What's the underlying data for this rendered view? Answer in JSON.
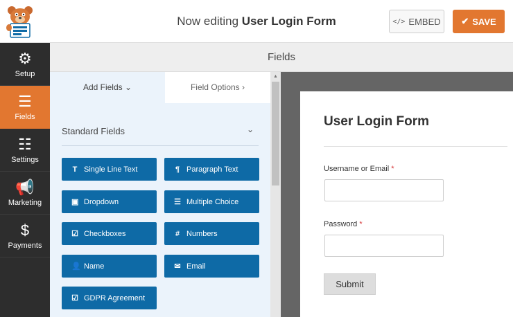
{
  "header": {
    "title_prefix": "Now editing",
    "form_name": "User Login Form",
    "embed_label": "EMBED",
    "embed_icon": "</>",
    "save_label": "SAVE",
    "save_color": "#e27730"
  },
  "sidebar": {
    "items": [
      {
        "label": "Setup",
        "icon": "gear-icon",
        "glyph": "⚙"
      },
      {
        "label": "Fields",
        "icon": "list-icon",
        "glyph": "☰",
        "active": true
      },
      {
        "label": "Settings",
        "icon": "sliders-icon",
        "glyph": "☷"
      },
      {
        "label": "Marketing",
        "icon": "megaphone-icon",
        "glyph": "📢"
      },
      {
        "label": "Payments",
        "icon": "dollar-icon",
        "glyph": "$"
      }
    ]
  },
  "fields_bar": {
    "title": "Fields"
  },
  "panel": {
    "tabs": [
      {
        "label": "Add Fields",
        "chevron": "⌄"
      },
      {
        "label": "Field Options",
        "chevron": "›"
      }
    ],
    "section_title": "Standard Fields",
    "section_chevron": "⌄",
    "fields": [
      {
        "label": "Single Line Text",
        "icon": "text-icon",
        "glyph": "T"
      },
      {
        "label": "Paragraph Text",
        "icon": "paragraph-icon",
        "glyph": "¶"
      },
      {
        "label": "Dropdown",
        "icon": "dropdown-icon",
        "glyph": "▣"
      },
      {
        "label": "Multiple Choice",
        "icon": "list-icon",
        "glyph": "☰"
      },
      {
        "label": "Checkboxes",
        "icon": "checkbox-icon",
        "glyph": "☑"
      },
      {
        "label": "Numbers",
        "icon": "hash-icon",
        "glyph": "#"
      },
      {
        "label": "Name",
        "icon": "user-icon",
        "glyph": "👤"
      },
      {
        "label": "Email",
        "icon": "envelope-icon",
        "glyph": "✉"
      },
      {
        "label": "GDPR Agreement",
        "icon": "checkbox-icon",
        "glyph": "☑"
      }
    ]
  },
  "preview": {
    "form_title": "User Login Form",
    "fields": [
      {
        "label": "Username or Email",
        "required_mark": "*"
      },
      {
        "label": "Password",
        "required_mark": "*"
      }
    ],
    "submit_label": "Submit"
  }
}
